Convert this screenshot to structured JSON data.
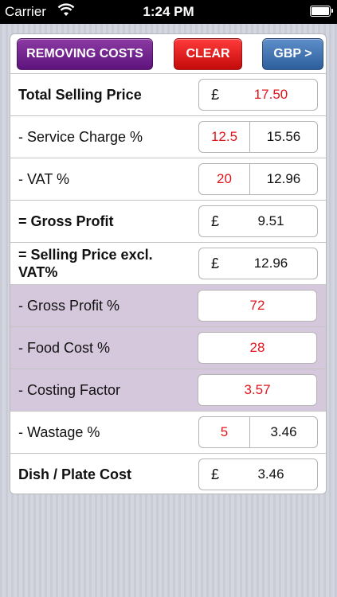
{
  "status_bar": {
    "carrier": "Carrier",
    "time": "1:24 PM",
    "wifi_icon": "wifi-icon",
    "battery_icon": "battery-icon"
  },
  "toolbar": {
    "removing_costs_label": "REMOVING COSTS",
    "clear_label": "CLEAR",
    "currency_label": "GBP >"
  },
  "colors": {
    "input_red": "#e0161c",
    "purple_row": "#d5c8dc",
    "removing_button": "#6f1f8d",
    "clear_button": "#d91414",
    "currency_button": "#3f72b3"
  },
  "currency_symbol": "£",
  "rows": {
    "total_selling_price": {
      "label": "Total Selling Price",
      "value": "17.50"
    },
    "service_charge": {
      "label": "- Service Charge %",
      "percent": "12.5",
      "value": "15.56"
    },
    "vat": {
      "label": "- VAT %",
      "percent": "20",
      "value": "12.96"
    },
    "gross_profit": {
      "label": "= Gross Profit",
      "value": "9.51"
    },
    "selling_price_excl_vat": {
      "label_line1": "= Selling Price excl.",
      "label_line2": "VAT%",
      "value": "12.96"
    },
    "gross_profit_pct": {
      "label": "-  Gross Profit %",
      "value": "72"
    },
    "food_cost_pct": {
      "label": "-  Food Cost %",
      "value": "28"
    },
    "costing_factor": {
      "label": "-  Costing Factor",
      "value": "3.57"
    },
    "wastage": {
      "label": "- Wastage %",
      "percent": "5",
      "value": "3.46"
    },
    "dish_plate_cost": {
      "label": "Dish / Plate Cost",
      "value": "3.46"
    }
  }
}
